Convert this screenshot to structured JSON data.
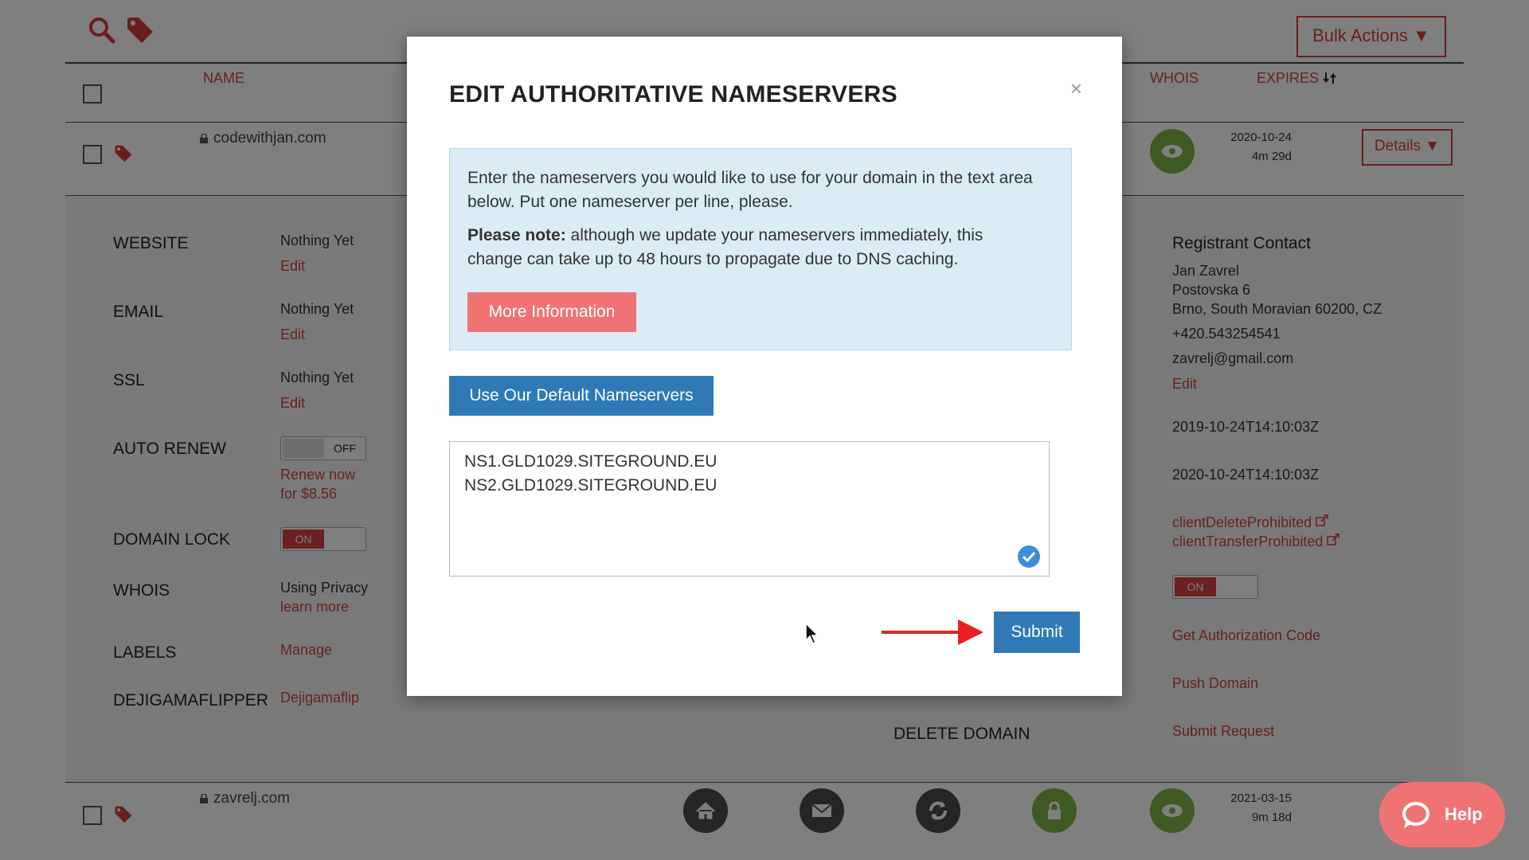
{
  "toolbar": {
    "bulk_actions_label": "Bulk Actions ▼"
  },
  "table_header": {
    "name": "NAME",
    "whois": "WHOIS",
    "expires": "EXPIRES"
  },
  "rows": [
    {
      "domain": "codewithjan.com",
      "expires_date": "2020-10-24",
      "expires_remaining": "4m 29d",
      "details_label": "Details ▼"
    },
    {
      "domain": "zavrelj.com",
      "expires_date": "2021-03-15",
      "expires_remaining": "9m 18d"
    }
  ],
  "details": {
    "website": {
      "label": "WEBSITE",
      "value": "Nothing Yet",
      "action": "Edit"
    },
    "email": {
      "label": "EMAIL",
      "value": "Nothing Yet",
      "action": "Edit"
    },
    "ssl": {
      "label": "SSL",
      "value": "Nothing Yet",
      "action": "Edit"
    },
    "auto_renew": {
      "label": "AUTO RENEW",
      "toggle": "OFF",
      "action": "Renew now for $8.56"
    },
    "domain_lock": {
      "label": "DOMAIN LOCK",
      "toggle": "ON"
    },
    "whois": {
      "label": "WHOIS",
      "value": "Using Privacy",
      "action": "learn more"
    },
    "labels": {
      "label": "LABELS",
      "action": "Manage"
    },
    "flipper": {
      "label": "DEJIGAMAFLIPPER",
      "action": "Dejigamaflip"
    },
    "delete_domain": "DELETE DOMAIN"
  },
  "registrant": {
    "heading": "Registrant Contact",
    "name": "Jan Zavrel",
    "street": "Postovska 6",
    "city": "Brno, South Moravian 60200, CZ",
    "phone": "+420.543254541",
    "email": "zavrelj@gmail.com",
    "edit": "Edit",
    "created": "2019-10-24T14:10:03Z",
    "expires": "2020-10-24T14:10:03Z",
    "status_1": "clientDeleteProhibited",
    "status_2": "clientTransferProhibited",
    "privacy_toggle": "ON",
    "auth_code": "Get Authorization Code",
    "push": "Push Domain",
    "submit_request": "Submit Request"
  },
  "modal": {
    "title": "EDIT AUTHORITATIVE NAMESERVERS",
    "close": "×",
    "info_line": "Enter the nameservers you would like to use for your domain in the text area below. Put one nameserver per line, please.",
    "note_label": "Please note:",
    "note_text": " although we update your nameservers immediately, this change can take up to 48 hours to propagate due to DNS caching.",
    "more_info": "More Information",
    "default_ns": "Use Our Default Nameservers",
    "nameservers": "NS1.GLD1029.SITEGROUND.EU\nNS2.GLD1029.SITEGROUND.EU",
    "submit": "Submit"
  },
  "help": {
    "label": "Help"
  },
  "colors": {
    "brand_red": "#d63c3c",
    "primary_blue": "#2f79b6",
    "info_bg": "#dcecf5",
    "green": "#7db544",
    "dark_icon": "#4a4a4a"
  }
}
